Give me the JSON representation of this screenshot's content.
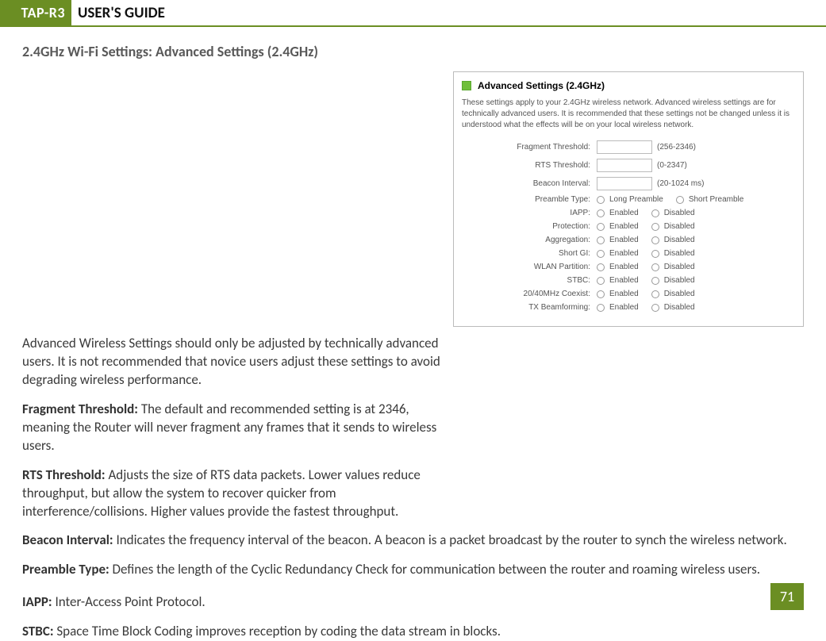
{
  "header": {
    "product": "TAP-R3",
    "title": "USER'S GUIDE"
  },
  "section_title": "2.4GHz Wi-Fi Settings: Advanced Settings (2.4GHz)",
  "paragraphs": {
    "intro": "Advanced Wireless Settings should only be adjusted by technically advanced users. It is not recommended that novice users adjust these settings to avoid degrading wireless performance.",
    "fragment_label": "Fragment Threshold:",
    "fragment_text": " The default and recommended setting is at 2346, meaning the Router will never fragment any frames that it sends to wireless users.",
    "rts_label": "RTS Threshold:",
    "rts_text": " Adjusts the size of RTS data packets. Lower values reduce throughput, but allow the system to recover quicker from interference/collisions. Higher values provide the fastest throughput.",
    "beacon_label": "Beacon Interval:",
    "beacon_text": " Indicates the frequency interval of the beacon. A beacon is a packet broadcast by the router to synch the wireless network.",
    "preamble_label": "Preamble Type:",
    "preamble_text": " Defines the length of the Cyclic Redundancy Check for communication between the router and roaming wireless users.",
    "iapp_label": "IAPP:",
    "iapp_text": " Inter-Access Point Protocol.",
    "stbc_label": "STBC:",
    "stbc_text": " Space Time Block Coding improves reception by coding the data stream in blocks."
  },
  "panel": {
    "title": "Advanced Settings (2.4GHz)",
    "description": "These settings apply to your 2.4GHz wireless network. Advanced wireless settings are for technically advanced users. It is recommended that these settings not be changed unless it is understood what the effects will be on your local wireless network.",
    "text_rows": [
      {
        "label": "Fragment Threshold:",
        "hint": "(256-2346)"
      },
      {
        "label": "RTS Threshold:",
        "hint": "(0-2347)"
      },
      {
        "label": "Beacon Interval:",
        "hint": "(20-1024 ms)"
      }
    ],
    "preamble_row": {
      "label": "Preamble Type:",
      "opt1": "Long Preamble",
      "opt2": "Short Preamble"
    },
    "radio_rows": [
      {
        "label": "IAPP:",
        "opt1": "Enabled",
        "opt2": "Disabled"
      },
      {
        "label": "Protection:",
        "opt1": "Enabled",
        "opt2": "Disabled"
      },
      {
        "label": "Aggregation:",
        "opt1": "Enabled",
        "opt2": "Disabled"
      },
      {
        "label": "Short GI:",
        "opt1": "Enabled",
        "opt2": "Disabled"
      },
      {
        "label": "WLAN Partition:",
        "opt1": "Enabled",
        "opt2": "Disabled"
      },
      {
        "label": "STBC:",
        "opt1": "Enabled",
        "opt2": "Disabled"
      },
      {
        "label": "20/40MHz Coexist:",
        "opt1": "Enabled",
        "opt2": "Disabled"
      },
      {
        "label": "TX Beamforming:",
        "opt1": "Enabled",
        "opt2": "Disabled"
      }
    ]
  },
  "page_number": "71"
}
